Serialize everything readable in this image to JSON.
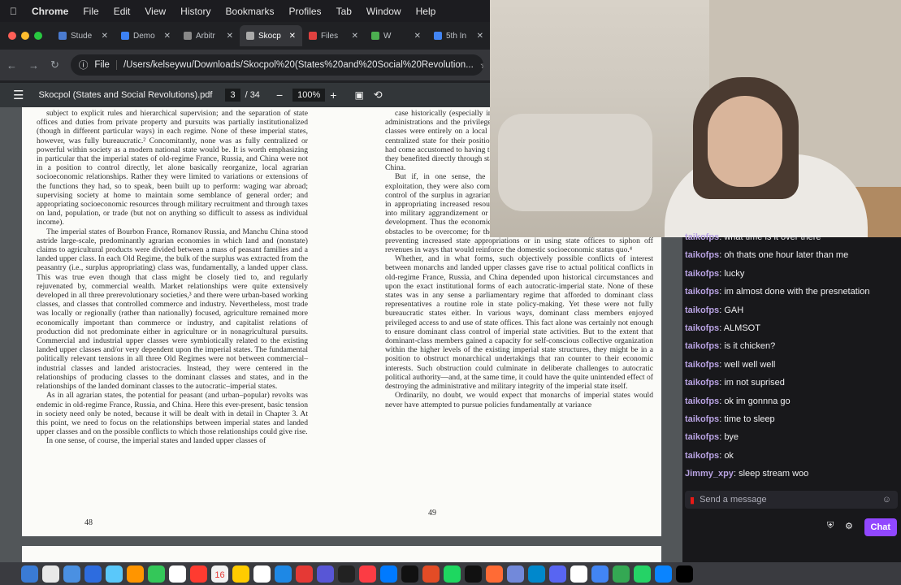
{
  "menubar": {
    "app": "Chrome",
    "items": [
      "File",
      "Edit",
      "View",
      "History",
      "Bookmarks",
      "Profiles",
      "Tab",
      "Window",
      "Help"
    ]
  },
  "tabs": [
    {
      "label": "Stude",
      "color": "#4a7bd0"
    },
    {
      "label": "Demo",
      "color": "#3c82f6"
    },
    {
      "label": "Arbitr",
      "color": "#888888"
    },
    {
      "label": "Skocp",
      "color": "#aaaaaa"
    },
    {
      "label": "Files",
      "color": "#e0413f"
    },
    {
      "label": "W",
      "color": "#4caf50"
    },
    {
      "label": "5th In",
      "color": "#4285f4"
    }
  ],
  "url": {
    "prefix": "File",
    "path": "/Users/kelseywu/Downloads/Skocpol%20(States%20and%20Social%20Revolution..."
  },
  "pdf": {
    "title": "Skocpol (States and Social Revolutions).pdf",
    "page": "3",
    "total": "/ 34",
    "zoom": "100%"
  },
  "page": {
    "left_text": [
      "subject to explicit rules and hierarchical supervision; and the separation of state offices and duties from private property and pursuits was partially institutionalized (though in different particular ways) in each regime. None of these imperial states, however, was fully bureaucratic.² Concomitantly, none was as fully centralized or powerful within society as a modern national state would be. It is worth emphasizing in particular that the imperial states of old-regime France, Russia, and China were not in a position to control directly, let alone basically reorganize, local agrarian socioeconomic relationships. Rather they were limited to variations or extensions of the functions they had, so to speak, been built up to perform: waging war abroad; supervising society at home to maintain some semblance of general order; and appropriating socioeconomic resources through military recruitment and through taxes on land, population, or trade (but not on anything so difficult to assess as individual income).",
      "The imperial states of Bourbon France, Romanov Russia, and Manchu China stood astride large-scale, predominantly agrarian economies in which land and (nonstate) claims to agricultural products were divided between a mass of peasant families and a landed upper class. In each Old Regime, the bulk of the surplus was extracted from the peasantry (i.e., surplus appropriating) class was, fundamentally, a landed upper class. This was true even though that class might be closely tied to, and regularly rejuvenated by, commercial wealth. Market relationships were quite extensively developed in all three prerevolutionary societies,³ and there were urban-based working classes, and classes that controlled commerce and industry. Nevertheless, most trade was locally or regionally (rather than nationally) focused, agriculture remained more economically important than commerce or industry, and capitalist relations of production did not predominate either in agriculture or in nonagricultural pursuits. Commercial and industrial upper classes were symbiotically related to the existing landed upper classes and/or very dependent upon the imperial states. The fundamental politically relevant tensions in all three Old Regimes were not between commercial–industrial classes and landed aristocracies. Instead, they were centered in the relationships of producing classes to the dominant classes and states, and in the relationships of the landed dominant classes to the autocratic–imperial states.",
      "As in all agrarian states, the potential for peasant (and urban–popular) revolts was endemic in old-regime France, Russia, and China. Here this ever-present, basic tension in society need only be noted, because it will be dealt with in detail in Chapter 3. At this point, we need to focus on the relationships between imperial states and landed upper classes and on the possible conflicts to which those relationships could give rise.",
      "In one sense, of course, the imperial states and landed upper classes of"
    ],
    "right_text": [
      "case historically (especially in France), as in the end of this and the centralized administrations and the privileges challenged by the landed classes. The dominant classes were entirely on a local basis; they depended to varying degrees, upon the centralized state for their positions and prerogatives. Whereas the dominant classes had come accustomed to having their interests represented through state service. And, they benefited directly through state office-holding in old-regime France, Russia, and China.",
      "But if, in one sense, the monarchs and landed classes were partners in exploitation, they were also competitors for the manpower of the peasantry and for control of the surplus in agrarian-commercial economies. Monarchs were interested in appropriating increased resources from society and channeling them efficiently into military aggrandizement or state-sponsored and centrally controlled economic development. Thus the economic interests of the landed upper classes were in part obstacles to be overcome; for the landed classes were primarily interested either in preventing increased state appropriations or in using state offices to siphon off revenues in ways that would reinforce the domestic socioeconomic status quo.⁴",
      "Whether, and in what forms, such objectively possible conflicts of interest between monarchs and landed upper classes gave rise to actual political conflicts in old-regime France, Russia, and China depended upon historical circumstances and upon the exact institutional forms of each autocratic-imperial state. None of these states was in any sense a parliamentary regime that afforded to dominant class representatives a routine role in state policy-making. Yet these were not fully bureaucratic states either. In various ways, dominant class members enjoyed privileged access to and use of state offices. This fact alone was certainly not enough to ensure dominant class control of imperial state activities. But to the extent that dominant-class members gained a capacity for self-conscious collective organization within the higher levels of the existing imperial state structures, they might be in a position to obstruct monarchical undertakings that ran counter to their economic interests. Such obstruction could culminate in deliberate challenges to autocratic political authority—and, at the same time, it could have the quite unintended effect of destroying the administrative and military integrity of the imperial state itself.",
      "Ordinarily, no doubt, we would expect that monarchs of imperial states would never have attempted to pursue policies fundamentally at variance"
    ],
    "left_number": "48",
    "right_number": "49"
  },
  "chat": {
    "messages": [
      {
        "user": "taikofps",
        "text": "what time is it over there"
      },
      {
        "user": "taikofps",
        "text": "oh thats one hour later than me"
      },
      {
        "user": "taikofps",
        "text": "lucky"
      },
      {
        "user": "taikofps",
        "text": "im almost done with the presnetation"
      },
      {
        "user": "taikofps",
        "text": "GAH"
      },
      {
        "user": "taikofps",
        "text": "ALMSOT"
      },
      {
        "user": "taikofps",
        "text": "is it chicken?"
      },
      {
        "user": "taikofps",
        "text": "well well well"
      },
      {
        "user": "taikofps",
        "text": "im not suprised"
      },
      {
        "user": "taikofps",
        "text": "ok im gonnna go"
      },
      {
        "user": "taikofps",
        "text": "time to sleep"
      },
      {
        "user": "taikofps",
        "text": "bye"
      },
      {
        "user": "taikofps",
        "text": "ok"
      },
      {
        "user": "Jimmy_xpy",
        "text": "sleep stream woo"
      }
    ],
    "placeholder": "Send a message",
    "button": "Chat"
  },
  "dock": {
    "colors": [
      "#3a7bd5",
      "#e8e8e8",
      "#4a90e2",
      "#2d6cdf",
      "#5ac8fa",
      "#ff9500",
      "#34c759",
      "#ffffff",
      "#ff3b30",
      "#f2f2f2",
      "#ffcc00",
      "#ffffff",
      "#1e88e5",
      "#e53935",
      "#5856d6",
      "#222222",
      "#fc3c44",
      "#007aff",
      "#111111",
      "#e34c26",
      "#1ed760",
      "#111111",
      "#ff6b35",
      "#7289da",
      "#0088cc",
      "#5865f2",
      "#ffffff",
      "#4285f4",
      "#34a853",
      "#25d366",
      "#0a84ff",
      "#000000"
    ],
    "date": "16"
  }
}
